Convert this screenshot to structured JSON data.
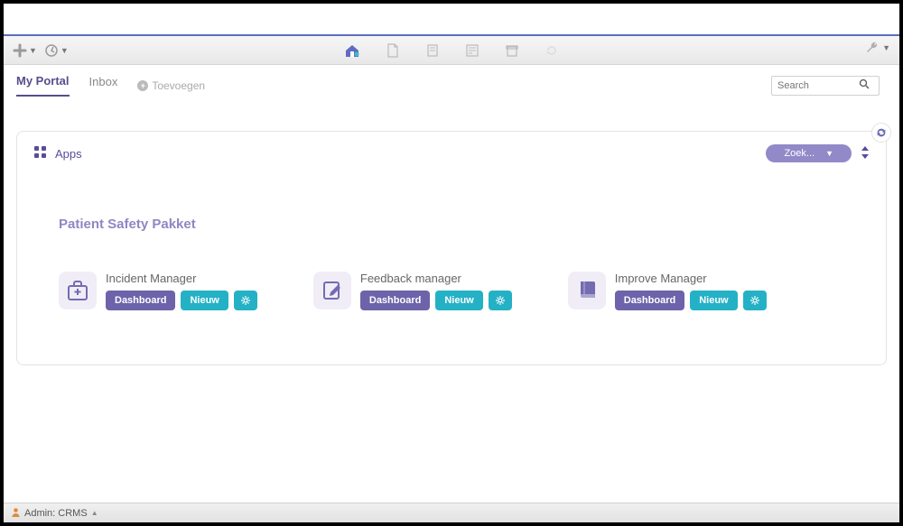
{
  "tabs": {
    "my_portal": "My Portal",
    "inbox": "Inbox",
    "add": "Toevoegen"
  },
  "search": {
    "placeholder": "Search"
  },
  "apps_panel": {
    "title": "Apps",
    "filter_label": "Zoek...",
    "section_title": "Patient Safety Pakket",
    "dashboard_label": "Dashboard",
    "new_label": "Nieuw",
    "apps": [
      {
        "title": "Incident Manager"
      },
      {
        "title": "Feedback manager"
      },
      {
        "title": "Improve Manager"
      }
    ]
  },
  "statusbar": {
    "user": "Admin: CRMS"
  }
}
